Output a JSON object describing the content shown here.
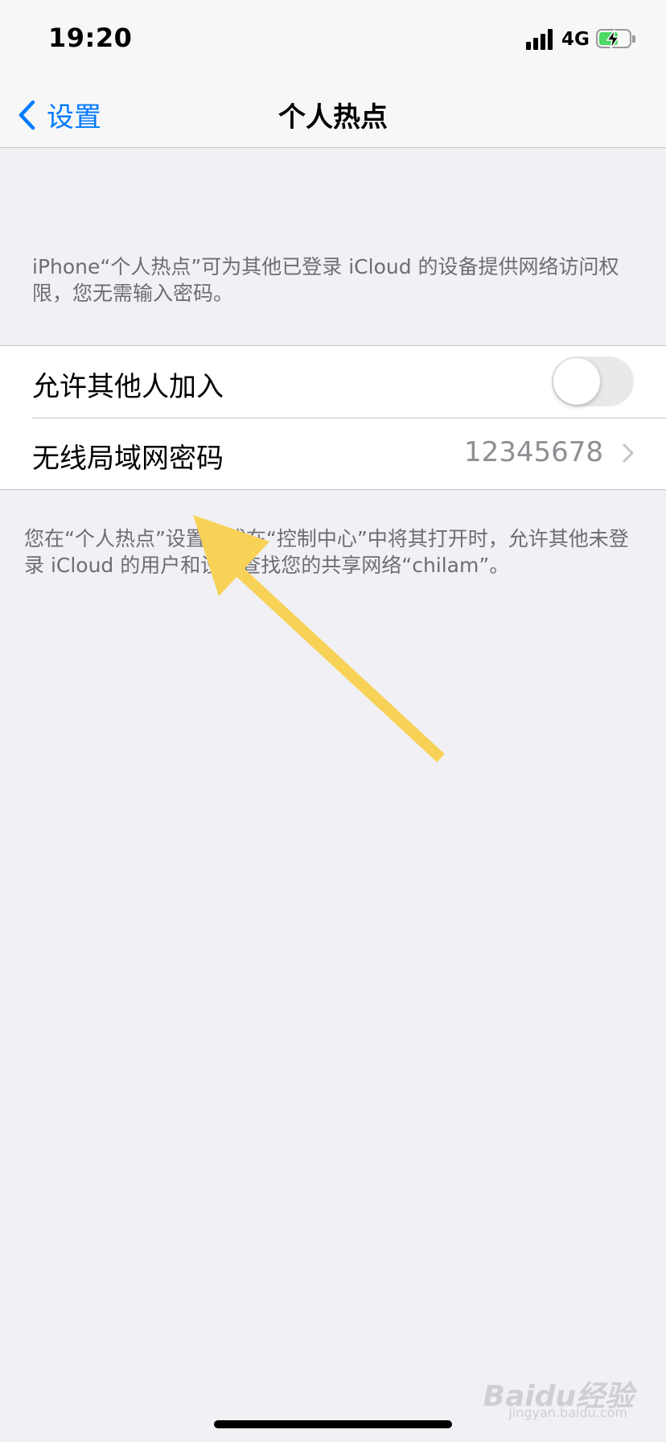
{
  "status_bar": {
    "time": "19:20",
    "network": "4G",
    "battery_level": 0.65,
    "battery_charging": true
  },
  "nav": {
    "back_label": "设置",
    "title": "个人热点"
  },
  "description_top": "iPhone“个人热点”可为其他已登录 iCloud 的设备提供网络访问权限，您无需输入密码。",
  "settings": {
    "allow_others": {
      "label": "允许其他人加入",
      "enabled": false
    },
    "wifi_password": {
      "label": "无线局域网密码",
      "value": "12345678"
    }
  },
  "description_bottom": "您在“个人热点”设置中或在“控制中心”中将其打开时，允许其他未登录 iCloud 的用户和设备查找您的共享网络“chilam”。",
  "watermark": {
    "brand": "Baidu经验",
    "url": "jingyan.baidu.com"
  },
  "colors": {
    "accent": "#007aff",
    "background": "#f0f0f5",
    "annotation_arrow": "#f8d257"
  },
  "icons": {
    "back": "chevron-left-icon",
    "row_disclosure": "chevron-right-icon",
    "signal": "cellular-signal-icon",
    "battery": "battery-charging-icon"
  }
}
